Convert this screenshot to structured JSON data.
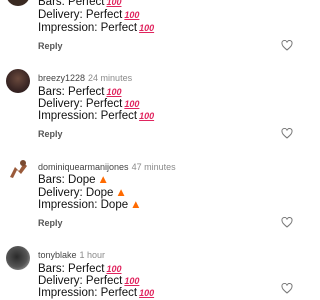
{
  "comments": [
    {
      "username": "",
      "time": "",
      "lines": [
        "Bars: Perfect",
        "Delivery: Perfect",
        "Impression: Perfect"
      ],
      "emoji": "💯",
      "reply_label": "Reply"
    },
    {
      "username": "breezy1228",
      "time": "24 minutes",
      "lines": [
        "Bars: Perfect",
        "Delivery: Perfect",
        "Impression: Perfect"
      ],
      "emoji": "💯",
      "reply_label": "Reply"
    },
    {
      "username": "dominiquearmanijones",
      "time": "47 minutes",
      "lines": [
        "Bars: Dope",
        "Delivery: Dope",
        "Impression: Dope"
      ],
      "emoji": "🔥",
      "reply_label": "Reply"
    },
    {
      "username": "tonyblake",
      "time": "1 hour",
      "lines": [
        "Bars: Perfect",
        "Delivery: Perfect",
        "Impression: Perfect"
      ],
      "emoji": "💯",
      "reply_label": ""
    }
  ]
}
